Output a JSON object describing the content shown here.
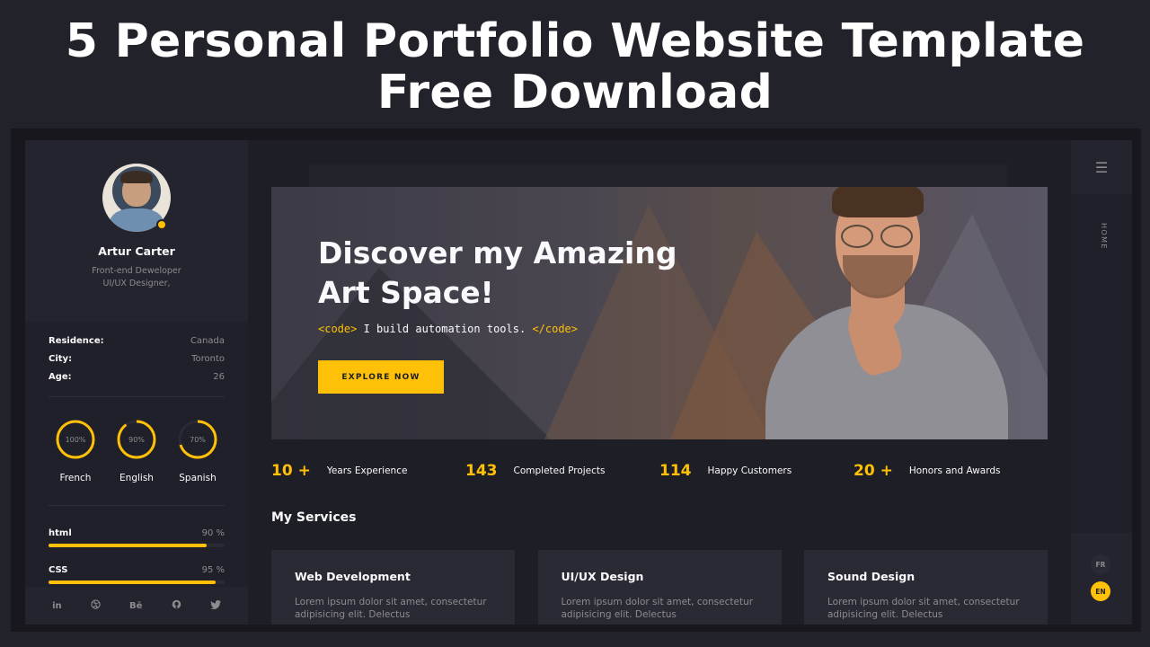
{
  "headline": {
    "line1": "5 Personal Portfolio Website Template",
    "line2": "Free Download"
  },
  "sidebar": {
    "name": "Artur Carter",
    "role_line1": "Front-end Deweloper",
    "role_line2": "UI/UX Designer,",
    "info": [
      {
        "key": "Residence:",
        "value": "Canada"
      },
      {
        "key": "City:",
        "value": "Toronto"
      },
      {
        "key": "Age:",
        "value": "26"
      }
    ],
    "languages": [
      {
        "label": "French",
        "percent_text": "100%",
        "level": 1.0
      },
      {
        "label": "English",
        "percent_text": "90%",
        "level": 0.9
      },
      {
        "label": "Spanish",
        "percent_text": "70%",
        "level": 0.7
      }
    ],
    "skills": [
      {
        "label": "html",
        "percent_text": "90 %",
        "level": 0.9
      },
      {
        "label": "CSS",
        "percent_text": "95 %",
        "level": 0.95
      }
    ],
    "socials": [
      "in",
      "dribbble-icon",
      "Bē",
      "github-icon",
      "twitter-icon"
    ]
  },
  "hero": {
    "title": "Discover my Amazing Art Space!",
    "code_open": "<code>",
    "code_text": " I build automation tools. ",
    "code_close": "</code>",
    "button": "EXPLORE NOW"
  },
  "stats": [
    {
      "number": "10 +",
      "label": "Years Experience"
    },
    {
      "number": "143",
      "label": "Completed Projects"
    },
    {
      "number": "114",
      "label": "Happy Customers"
    },
    {
      "number": "20 +",
      "label": "Honors and Awards"
    }
  ],
  "services": {
    "title": "My Services",
    "cards": [
      {
        "title": "Web Development",
        "desc": "Lorem ipsum dolor sit amet, consectetur adipisicing elit. Delectus"
      },
      {
        "title": "UI/UX Design",
        "desc": "Lorem ipsum dolor sit amet, consectetur adipisicing elit. Delectus"
      },
      {
        "title": "Sound Design",
        "desc": "Lorem ipsum dolor sit amet, consectetur adipisicing elit. Delectus"
      }
    ]
  },
  "rail": {
    "menu_icon": "hamburger-icon",
    "nav_label": "HOME",
    "lang_fr": "FR",
    "lang_en": "EN"
  },
  "colors": {
    "accent": "#ffc107",
    "background": "#1e1e26",
    "panel": "#24242e",
    "muted_text": "#8c8c8e"
  }
}
